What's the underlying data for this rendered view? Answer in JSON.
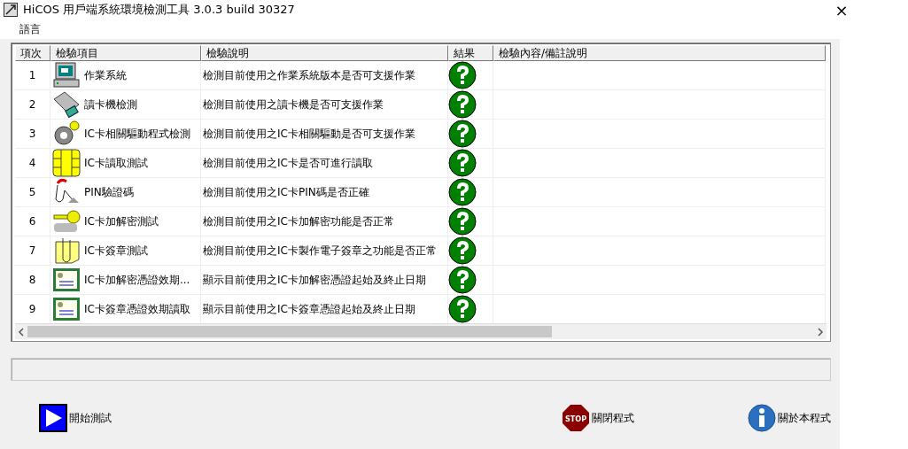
{
  "window": {
    "title": "HiCOS 用戶端系統環境檢測工具 3.0.3 build 30327",
    "close": "×"
  },
  "menu": [
    "語言"
  ],
  "table": {
    "columns": [
      "項次",
      "檢驗項目",
      "檢驗說明",
      "結果",
      "檢驗內容/備註說明"
    ],
    "rows": [
      {
        "no": "1",
        "item": "作業系統",
        "desc": "檢測目前使用之作業系統版本是否可支援作業",
        "kind": "pending"
      },
      {
        "no": "2",
        "item": "讀卡機檢測",
        "desc": "檢測目前使用之讀卡機是否可支援作業",
        "kind": "pending"
      },
      {
        "no": "3",
        "item": "IC卡相關驅動程式檢測",
        "desc": "檢測目前使用之IC卡相關驅動是否可支援作業",
        "kind": "pending"
      },
      {
        "no": "4",
        "item": "IC卡讀取測試",
        "desc": "檢測目前使用之IC卡是否可進行讀取",
        "kind": "pending"
      },
      {
        "no": "5",
        "item": "PIN驗證碼",
        "desc": "檢測目前使用之IC卡PIN碼是否正確",
        "kind": "pending"
      },
      {
        "no": "6",
        "item": "IC卡加解密測試",
        "desc": "檢測目前使用之IC卡加解密功能是否正常",
        "kind": "pending"
      },
      {
        "no": "7",
        "item": "IC卡簽章測試",
        "desc": "檢測目前使用之IC卡製作電子簽章之功能是否正常",
        "kind": "pending"
      },
      {
        "no": "8",
        "item": "IC卡加解密憑證效期...",
        "desc": "顯示目前使用之IC卡加解密憑證起始及終止日期",
        "kind": "pending"
      },
      {
        "no": "9",
        "item": "IC卡簽章憑證效期讀取",
        "desc": "顯示目前使用之IC卡簽章憑證起始及終止日期",
        "kind": "pending"
      }
    ]
  },
  "buttons": [
    {
      "kind": "start",
      "label": "開始測試"
    },
    {
      "kind": "stop",
      "label": "關閉程式",
      "icon_text": "STOP"
    },
    {
      "kind": "about",
      "label": "關於本程式"
    }
  ]
}
